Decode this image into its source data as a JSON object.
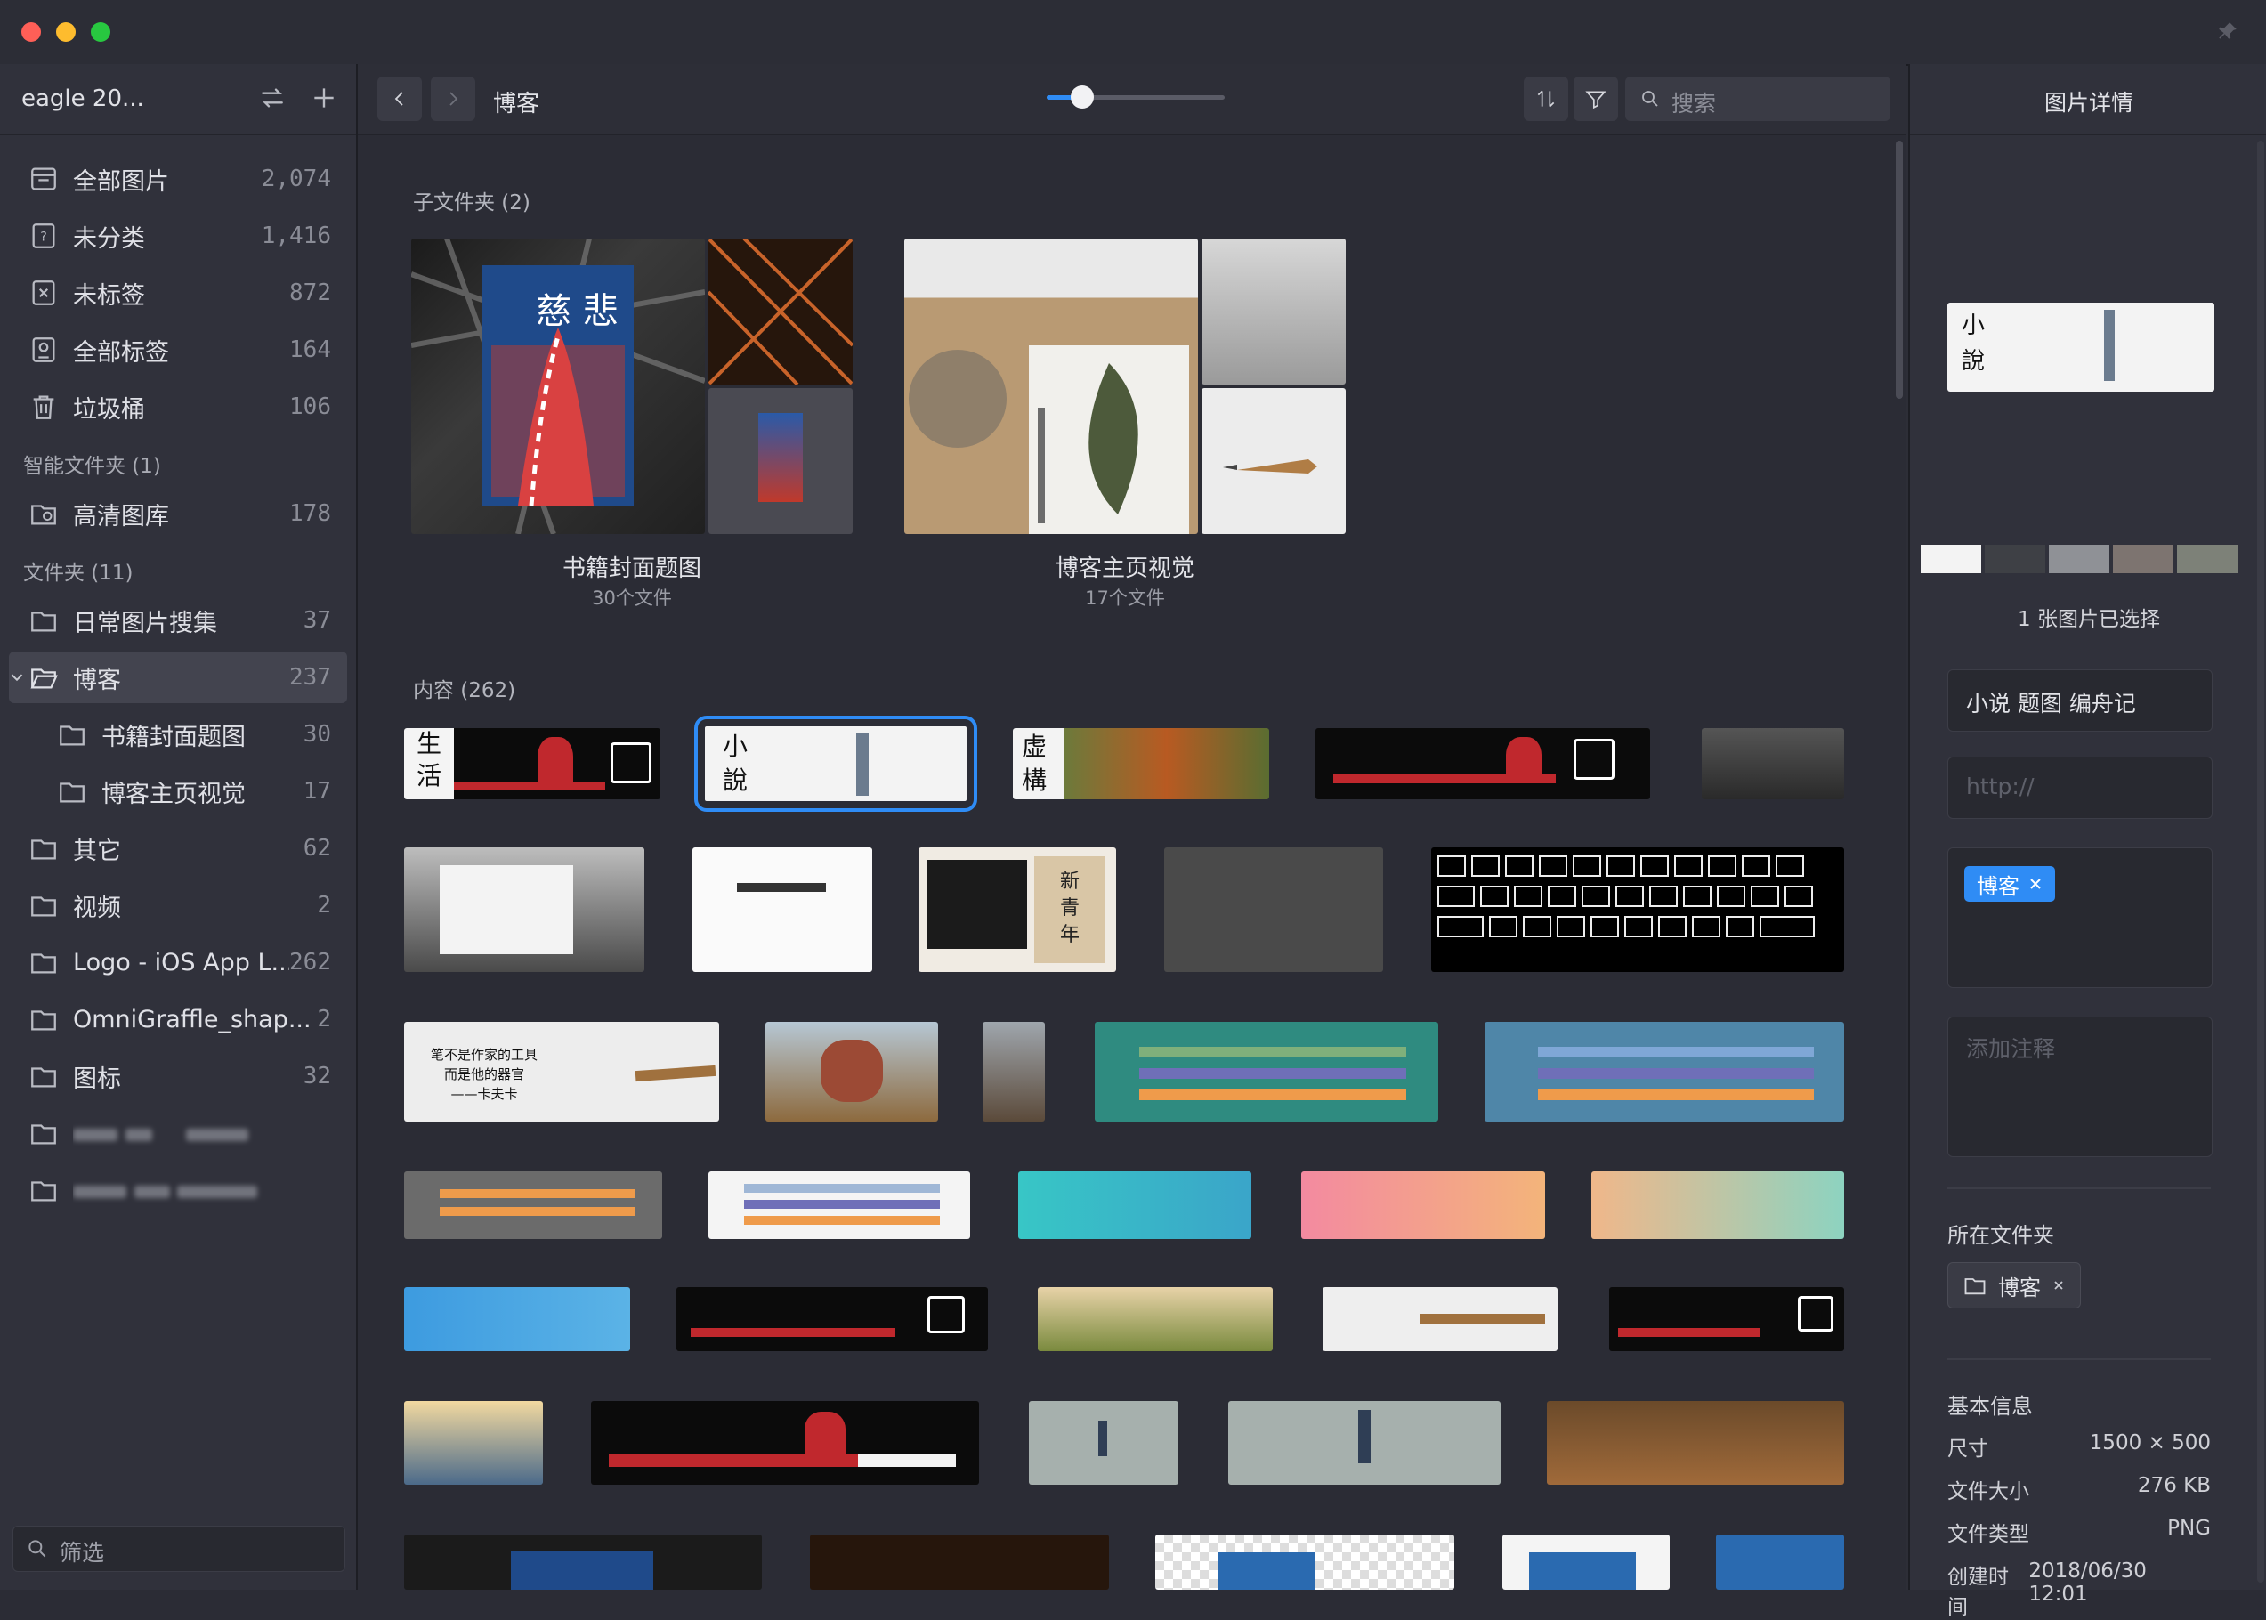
{
  "app": {
    "library_name": "eagle 20...",
    "breadcrumb": "博客",
    "zoom": 0.2
  },
  "sidebar": {
    "items": [
      {
        "label": "全部图片",
        "count": "2,074",
        "icon": "all-images-icon"
      },
      {
        "label": "未分类",
        "count": "1,416",
        "icon": "uncategorized-icon"
      },
      {
        "label": "未标签",
        "count": "872",
        "icon": "untagged-icon"
      },
      {
        "label": "全部标签",
        "count": "164",
        "icon": "all-tags-icon"
      },
      {
        "label": "垃圾桶",
        "count": "106",
        "icon": "trash-icon"
      }
    ],
    "smart_section": "智能文件夹 (1)",
    "smart_items": [
      {
        "label": "高清图库",
        "count": "178"
      }
    ],
    "folder_section": "文件夹 (11)",
    "folders": [
      {
        "label": "日常图片搜集",
        "count": "37"
      },
      {
        "label": "博客",
        "count": "237"
      },
      {
        "label": "书籍封面题图",
        "count": "30"
      },
      {
        "label": "博客主页视觉",
        "count": "17"
      },
      {
        "label": "其它",
        "count": "62"
      },
      {
        "label": "视频",
        "count": "2"
      },
      {
        "label": "Logo - iOS App L...",
        "count": "262"
      },
      {
        "label": "OmniGraffle_shap...",
        "count": "2"
      },
      {
        "label": "图标",
        "count": "32"
      }
    ],
    "filter_placeholder": "筛选"
  },
  "toolbar": {
    "search_placeholder": "搜索"
  },
  "main": {
    "subfolders_header": "子文件夹 (2)",
    "subfolders": [
      {
        "title": "书籍封面题图",
        "count": "30个文件"
      },
      {
        "title": "博客主页视觉",
        "count": "17个文件"
      }
    ],
    "content_header": "内容 (262)",
    "thumb_texts": {
      "life": [
        "生",
        "活"
      ],
      "novel": [
        "小",
        "說"
      ],
      "fiction": [
        "虚",
        "構"
      ],
      "cibei": "慈 悲",
      "xinqingnian": [
        "新",
        "青",
        "年"
      ],
      "pen_quote": [
        "笔不是作家的工具",
        "而是他的器官",
        "——卡夫卡"
      ]
    }
  },
  "details": {
    "title": "图片详情",
    "selected_text": "1 张图片已选择",
    "name_value": "小说 题图 编舟记",
    "url_placeholder": "http://",
    "tag": "博客",
    "notes_placeholder": "添加注释",
    "folder_label": "所在文件夹",
    "folder_chip": "博客",
    "basic_info_label": "基本信息",
    "info": [
      {
        "key": "尺寸",
        "value": "1500 × 500"
      },
      {
        "key": "文件大小",
        "value": "276 KB"
      },
      {
        "key": "文件类型",
        "value": "PNG"
      },
      {
        "key": "创建时间",
        "value": "2018/06/30 12:01"
      }
    ],
    "palette": [
      "#f3f3f3",
      "#3e4045",
      "#8f9196",
      "#7d7470",
      "#7d8178"
    ]
  },
  "colors": {
    "accent": "#2f8cf5",
    "close": "#fe5f57",
    "minimize": "#febc2e",
    "maximize": "#28c840"
  }
}
